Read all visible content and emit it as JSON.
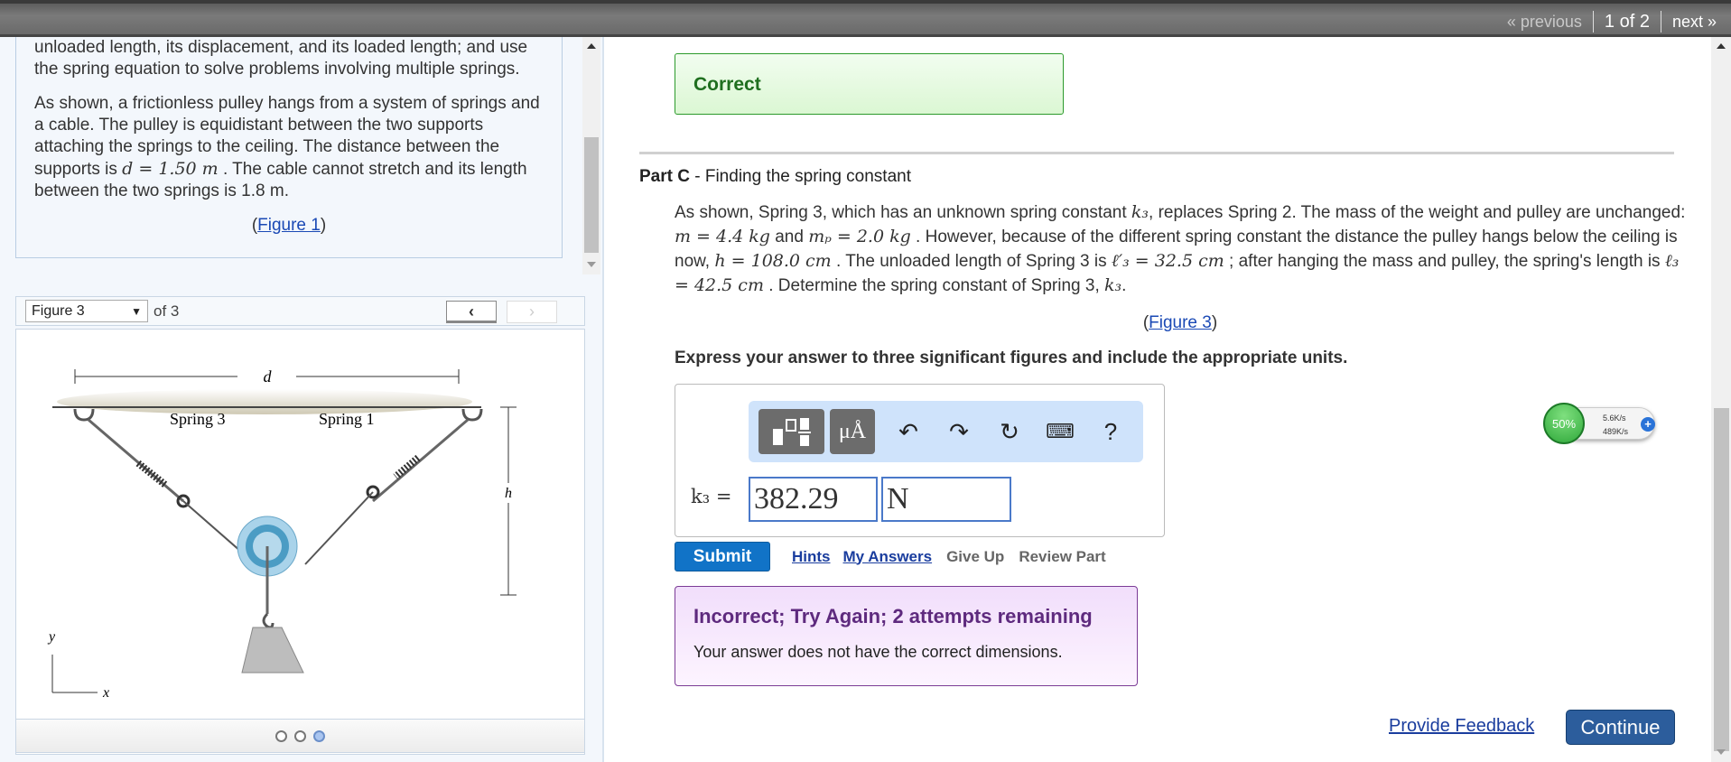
{
  "topnav": {
    "previous": "« previous",
    "position": "1 of 2",
    "next": "next »"
  },
  "intro": {
    "p1": "unloaded length, its displacement, and its loaded length; and use the spring equation to solve problems involving multiple springs.",
    "p2_a": "As shown, a frictionless pulley hangs from a system of springs and a cable. The pulley is equidistant between the two supports attaching the springs to the ceiling. The distance between the supports is ",
    "p2_math": "d = 1.50 m",
    "p2_b": " . The cable cannot stretch and its length between the two springs is 1.8 m.",
    "figure_link": "Figure 1"
  },
  "figure_panel": {
    "selected": "Figure 3",
    "of": "of 3",
    "prev": "‹",
    "next": "›",
    "labels": {
      "d": "d",
      "h": "h",
      "spring_left": "Spring 3",
      "spring_right": "Spring 1",
      "y": "y",
      "x": "x"
    },
    "current_page": 3,
    "total_pages": 3
  },
  "status_correct": "Correct",
  "part": {
    "label": "Part C",
    "title": " - Finding the spring constant",
    "s1": "As shown, Spring 3, which has an unknown spring constant ",
    "m_k3": "k₃",
    "s2": ", replaces Spring 2. The mass of the weight and pulley are unchanged: ",
    "m_m": "m = 4.4 kg",
    "s3": " and ",
    "m_mp": "mₚ = 2.0 kg",
    "s4": " . However, because of the different spring constant the distance the pulley hangs below the ceiling is now, ",
    "m_h": "h = 108.0 cm",
    "s5": " . The unloaded length of Spring 3 is ",
    "m_l3p": "ℓ′₃ = 32.5 cm",
    "s6": " ; after hanging the mass and pulley, the spring's length is ",
    "m_l3": "ℓ₃ = 42.5 cm",
    "s7": " . Determine the spring constant of Spring 3, ",
    "m_k3b": "k₃",
    "s8": ".",
    "figure_link": "Figure 3",
    "instruction": "Express your answer to three significant figures and include the appropriate units."
  },
  "answer": {
    "toolbar": {
      "units": "μÅ",
      "help": "?"
    },
    "label": "k₃ =",
    "value": "382.29",
    "unit": "N"
  },
  "actions": {
    "submit": "Submit",
    "hints": "Hints",
    "my_answers": "My Answers",
    "give_up": "Give Up",
    "review_part": "Review Part"
  },
  "feedback": {
    "title": "Incorrect; Try Again; 2 attempts remaining",
    "body": "Your answer does not have the correct dimensions."
  },
  "footer": {
    "provide_feedback": "Provide Feedback",
    "continue": "Continue"
  },
  "net_widget": {
    "percent": "50%",
    "up": "5.6K/s",
    "down": "489K/s"
  }
}
